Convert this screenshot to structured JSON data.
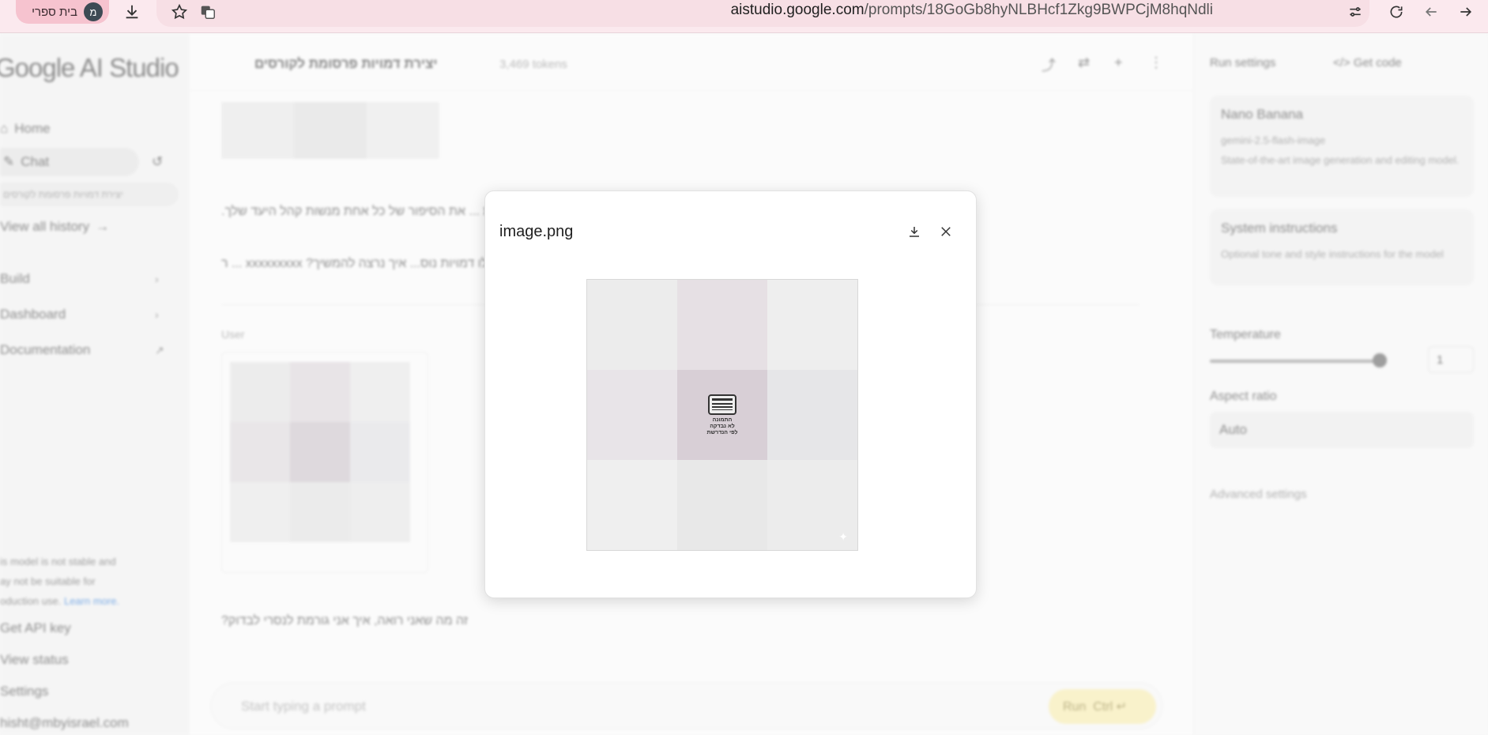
{
  "browser": {
    "profile_name": "בית ספרי",
    "profile_initial": "מ",
    "url_domain": "aistudio.google.com",
    "url_path": "/prompts/18GoGb8hyNLBHcf1Zkg9BWPCjM8hqNdli"
  },
  "sidebar": {
    "brand": "Google AI Studio",
    "home": "Home",
    "chat": "Chat",
    "current_chat": "יצירת דמויות פרסומת לקורסים",
    "view_history": "View all history",
    "build": "Build",
    "dashboard": "Dashboard",
    "documentation": "Documentation",
    "notice_line1": "is model is not stable and",
    "notice_line2": "ay not be suitable for",
    "notice_line3": "oduction use.",
    "notice_link": "Learn more.",
    "get_api_key": "Get API key",
    "view_status": "View status",
    "settings": "Settings",
    "account": "hisht@mbyisrael.com"
  },
  "main": {
    "title": "יצירת דמויות פרסומת לקורסים",
    "tokens": "3,469 tokens",
    "message_line1": "על בסיס הדמות ... את הסיפור של כל אחת מנשות קהל היעד שלך.",
    "message_line2": "אילו דמויות נוס... איך נרצה להמשיך? xxxxxxxxx ... ר",
    "user_label": "User",
    "user_message": "זה מה שאני רואה, איך אני גורמת לנסרי לבדוק?",
    "prompt_placeholder": "Start typing a prompt",
    "run_label": "Run",
    "run_shortcut": "Ctrl ↵"
  },
  "settings": {
    "title": "Run settings",
    "get_code": "Get code",
    "model_name": "Nano Banana",
    "model_id": "gemini-2.5-flash-image",
    "model_desc": "State-of-the-art image generation and editing model.",
    "sys_title": "System instructions",
    "sys_desc": "Optional tone and style instructions for the model",
    "temperature_label": "Temperature",
    "temperature_value": "1",
    "aspect_label": "Aspect ratio",
    "aspect_value": "Auto",
    "advanced": "Advanced settings"
  },
  "modal": {
    "title": "image.png",
    "center_text_line1": "התמונה",
    "center_text_line2": "לא נבדקה",
    "center_text_line3": "לפי הנדרשת",
    "cell_colors": [
      "#ececec",
      "#e6e0e4",
      "#eeeeee",
      "#e8e4e8",
      "#d8cfd6",
      "#e6e6e8",
      "#efefef",
      "#e8e8e8",
      "#ececec"
    ]
  }
}
